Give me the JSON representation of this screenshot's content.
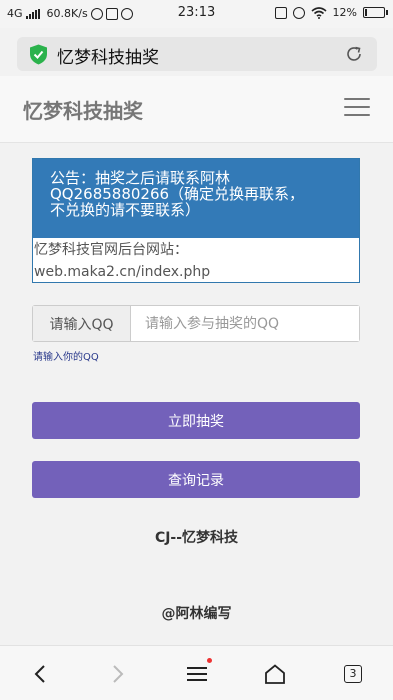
{
  "statusbar": {
    "network": "4G",
    "speed": "60.8K/s",
    "time": "23:13",
    "battery": "12%",
    "battery_level": 0.12
  },
  "browser": {
    "url_title": "忆梦科技抽奖",
    "shield_color": "#2bb24c"
  },
  "nav": {
    "brand": "忆梦科技抽奖"
  },
  "notice": {
    "line1": "公告：抽奖之后请联系阿林",
    "line2": "QQ2685880266（确定兑换再联系，",
    "line3": "不兑换的请不要联系）",
    "body1": "忆梦科技官网后台网站：",
    "body2": "web.maka2.cn/index.php"
  },
  "form": {
    "addon_label": "请输入QQ",
    "placeholder": "请输入参与抽奖的QQ",
    "help": "请输入你的QQ"
  },
  "buttons": {
    "draw": "立即抽奖",
    "query": "查询记录",
    "color": "#7361ba"
  },
  "footer": {
    "line1": "CJ--忆梦科技",
    "line2": "@阿林编写"
  },
  "bottombar": {
    "tabs_count": "3"
  }
}
